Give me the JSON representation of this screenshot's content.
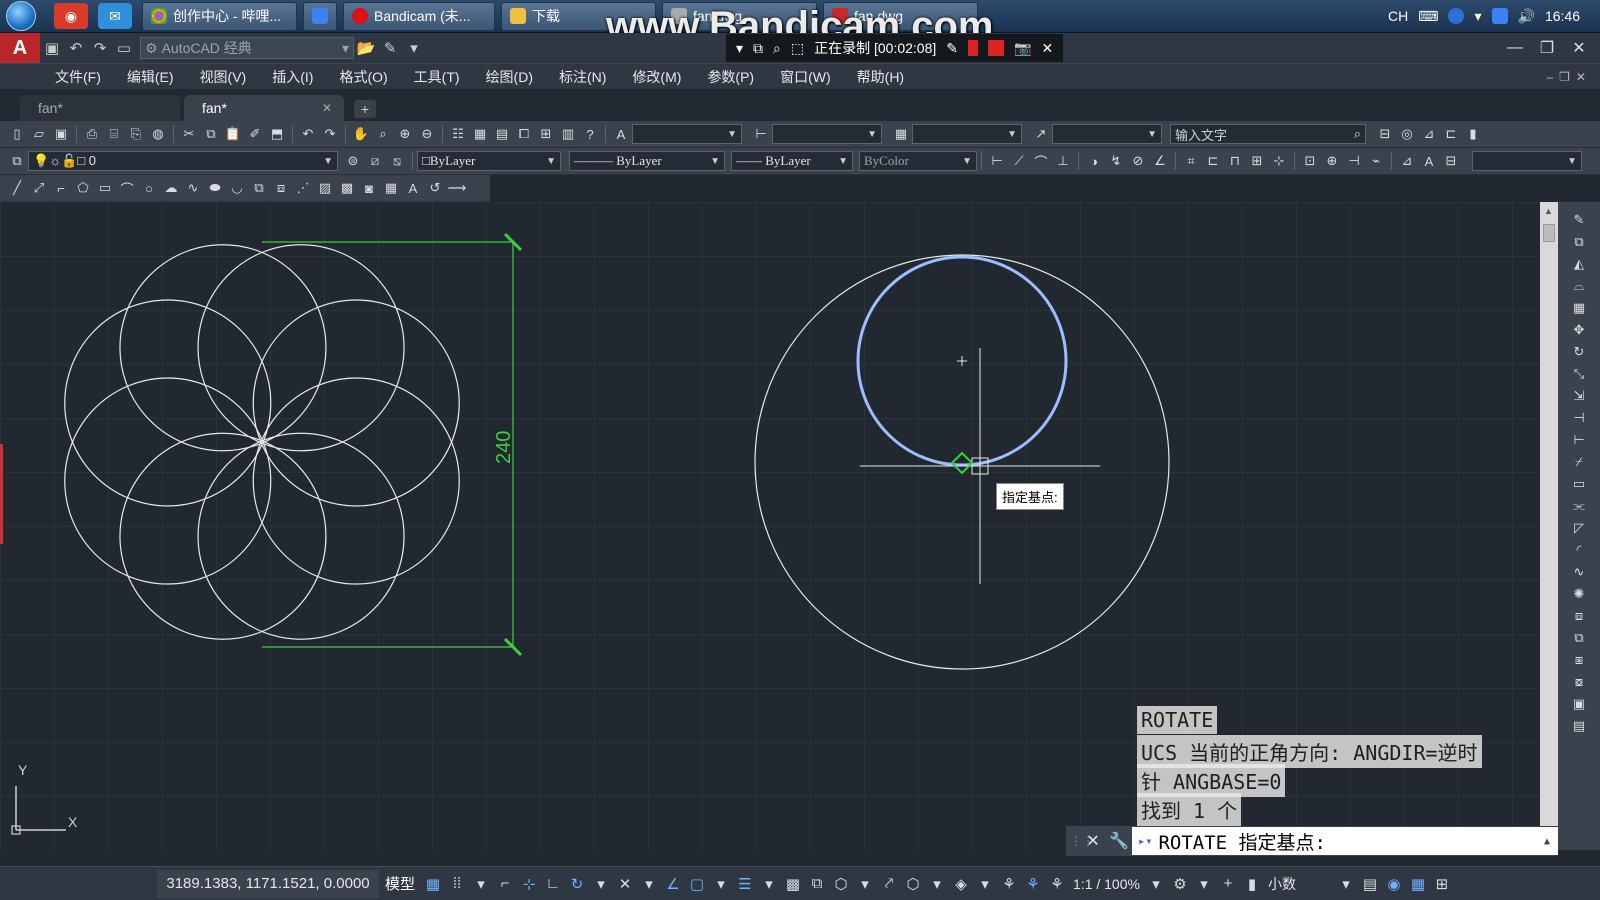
{
  "taskbar": {
    "buttons": [
      {
        "label": "创作中心 - 哔哩...",
        "icon": "chrome-icon"
      },
      {
        "label": "",
        "icon": "app-icon"
      },
      {
        "label": "Bandicam (未...",
        "icon": "bandicam-icon"
      },
      {
        "label": "下载",
        "icon": "folder-icon"
      },
      {
        "label": "fan.dwg",
        "icon": "dwg-icon"
      },
      {
        "label": "fan.dwg",
        "icon": "autocad-icon"
      }
    ],
    "tray": {
      "lang": "CH",
      "time": "16:46"
    }
  },
  "titlebar": {
    "workspace": "AutoCAD 经典",
    "recording_status": "正在录制 [00:02:08]",
    "watermark": "www.Bandicam.com"
  },
  "menu": [
    "文件(F)",
    "编辑(E)",
    "视图(V)",
    "插入(I)",
    "格式(O)",
    "工具(T)",
    "绘图(D)",
    "标注(N)",
    "修改(M)",
    "参数(P)",
    "窗口(W)",
    "帮助(H)"
  ],
  "doc_tabs": [
    {
      "label": "fan*",
      "active": false
    },
    {
      "label": "fan*",
      "active": true
    }
  ],
  "toolbar": {
    "search_placeholder": "输入文字",
    "layer": "0",
    "color": "ByLayer",
    "linetype": "ByLayer",
    "lineweight": "ByLayer",
    "plotstyle": "ByColor"
  },
  "drawing": {
    "dimension_text": "240",
    "tooltip": "指定基点:",
    "line_color": "#e8e8e8",
    "dimension_color": "#3bd13b",
    "selection_color": "#9dbdff"
  },
  "command": {
    "history": [
      "ROTATE",
      "UCS 当前的正角方向:  ANGDIR=逆时",
      "针  ANGBASE=0",
      "找到 1 个"
    ],
    "prompt": "ROTATE 指定基点:"
  },
  "ucs": {
    "x_label": "X",
    "y_label": "Y"
  },
  "status": {
    "coords": "3189.1383, 1171.1521, 0.0000",
    "model": "模型",
    "scale": "1:1 / 100%",
    "units": "小数"
  }
}
